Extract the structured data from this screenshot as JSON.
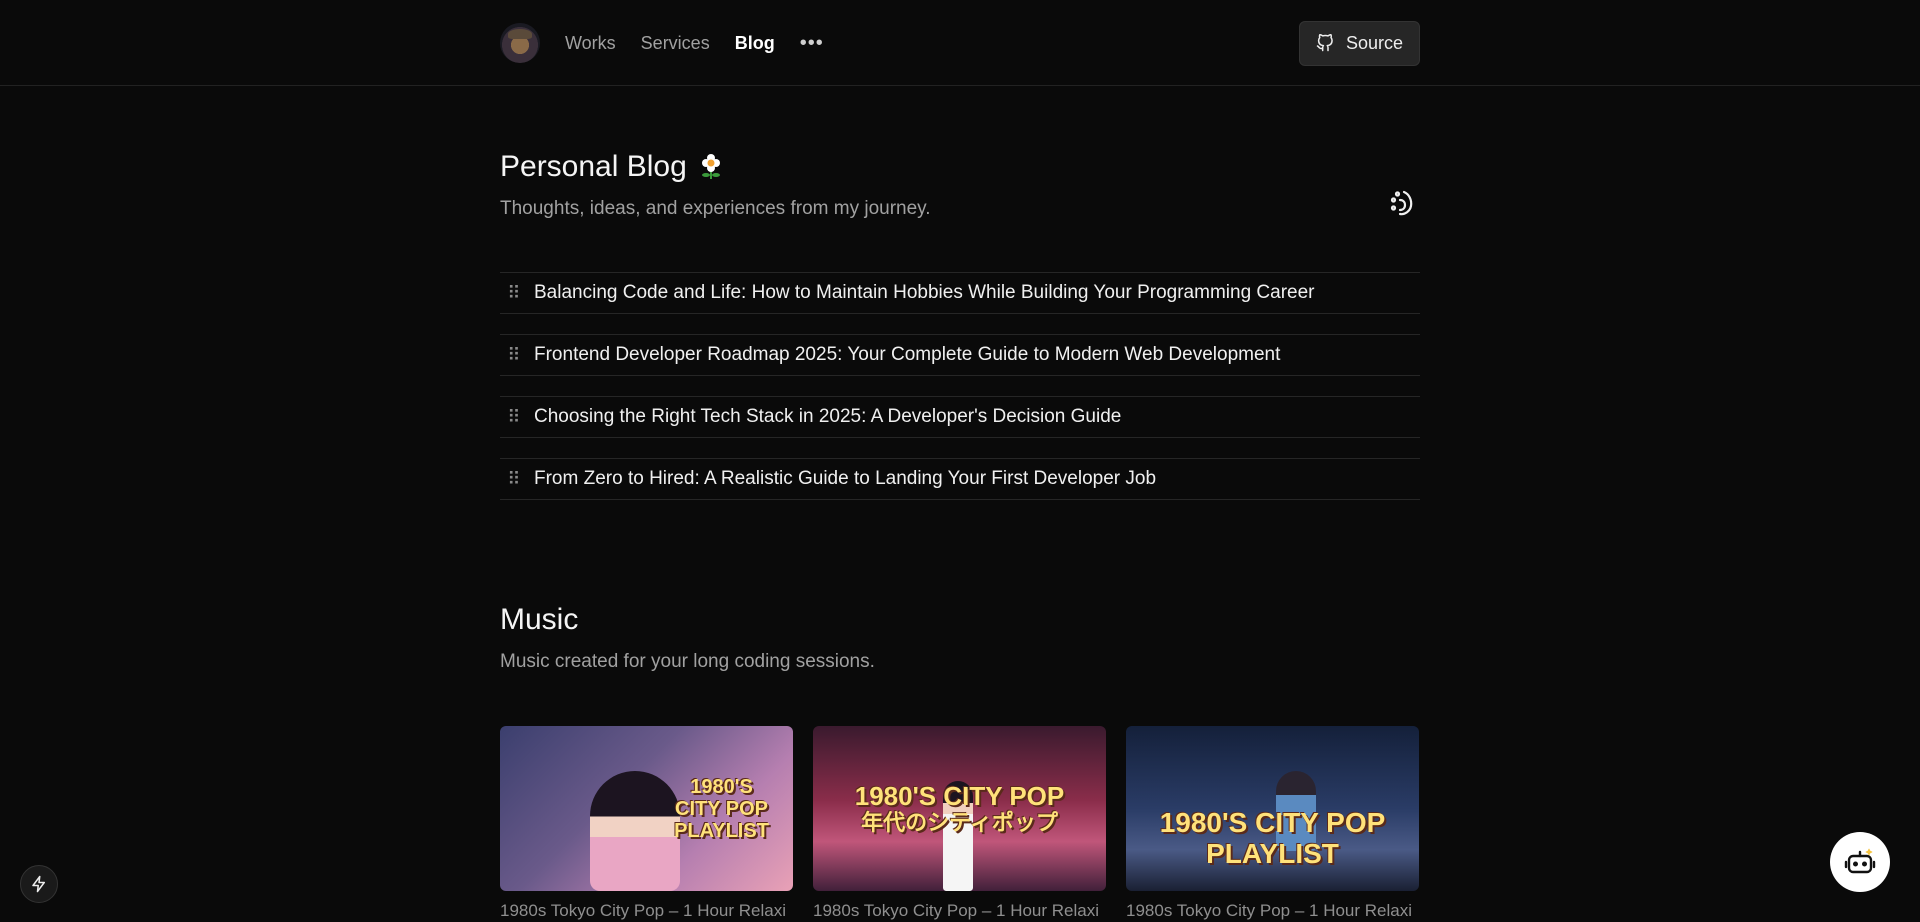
{
  "header": {
    "nav": [
      {
        "label": "Works",
        "active": false
      },
      {
        "label": "Services",
        "active": false
      },
      {
        "label": "Blog",
        "active": true
      }
    ],
    "more_label": "•••",
    "source_label": "Source"
  },
  "blog": {
    "title": "Personal Blog",
    "subtitle": "Thoughts, ideas, and experiences from my journey.",
    "posts": [
      {
        "title": "Balancing Code and Life: How to Maintain Hobbies While Building Your Programming Career"
      },
      {
        "title": "Frontend Developer Roadmap 2025: Your Complete Guide to Modern Web Development"
      },
      {
        "title": "Choosing the Right Tech Stack in 2025: A Developer's Decision Guide"
      },
      {
        "title": "From Zero to Hired: A Realistic Guide to Landing Your First Developer Job"
      }
    ]
  },
  "music": {
    "title": "Music",
    "subtitle": "Music created for your long coding sessions.",
    "tracks": [
      {
        "thumb_text": "1980'S CITY POP PLAYLIST",
        "thumb_sub": "",
        "title": "1980s Tokyo City Pop – 1 Hour Relaxi"
      },
      {
        "thumb_text": "1980'S CITY POP",
        "thumb_sub": "年代のシティポップ",
        "title": "1980s Tokyo City Pop – 1 Hour Relaxi"
      },
      {
        "thumb_text": "1980'S CITY POP PLAYLIST",
        "thumb_sub": "",
        "title": "1980s Tokyo City Pop – 1 Hour Relaxi"
      }
    ]
  },
  "icons": {
    "avatar": "avatar-image",
    "source": "github-icon",
    "blog_icon": "feather-cluster-icon",
    "drag": "drag-handle-icon",
    "bolt": "bolt-icon",
    "bot": "robot-icon"
  },
  "colors": {
    "background": "#0a0a0a",
    "text": "#ededed",
    "muted": "#a1a1a1",
    "border": "#262626"
  }
}
